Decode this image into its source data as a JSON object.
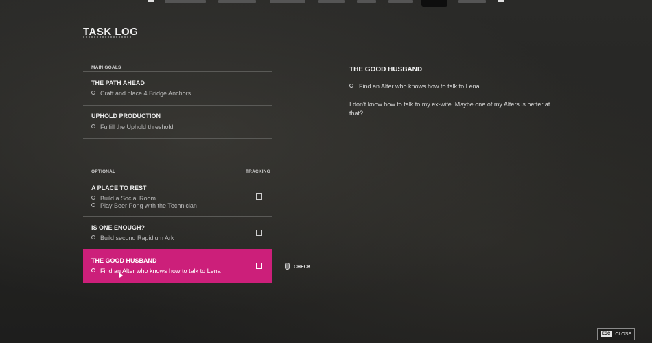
{
  "page": {
    "title": "TASK LOG"
  },
  "main_goals": {
    "header": "MAIN GOALS",
    "quests": [
      {
        "name": "THE PATH AHEAD",
        "objectives": [
          "Craft and place 4 Bridge Anchors"
        ]
      },
      {
        "name": "UPHOLD PRODUCTION",
        "objectives": [
          "Fulfill the Uphold threshold"
        ]
      }
    ]
  },
  "optional": {
    "header": "OPTIONAL",
    "tracking_header": "TRACKING",
    "quests": [
      {
        "name": "A PLACE TO REST",
        "objectives": [
          "Build a Social Room",
          "Play Beer Pong with the Technician"
        ],
        "tracked": false
      },
      {
        "name": "IS ONE ENOUGH?",
        "objectives": [
          "Build second Rapidium Ark"
        ],
        "tracked": false
      },
      {
        "name": "THE GOOD HUSBAND",
        "objectives": [
          "Find an Alter who knows how to talk to Lena"
        ],
        "tracked": false,
        "selected": true
      }
    ]
  },
  "check_prompt": {
    "label": "CHECK",
    "icon": "mouse-icon"
  },
  "detail": {
    "title": "THE GOOD HUSBAND",
    "objective": "Find an Alter who knows how to talk to Lena",
    "description": "I don't know how to talk to my ex-wife. Maybe one of my Alters is better at that?"
  },
  "close_button": {
    "key": "ESC",
    "label": "CLOSE"
  },
  "colors": {
    "accent": "#cc1f7a",
    "background": "#262624"
  }
}
